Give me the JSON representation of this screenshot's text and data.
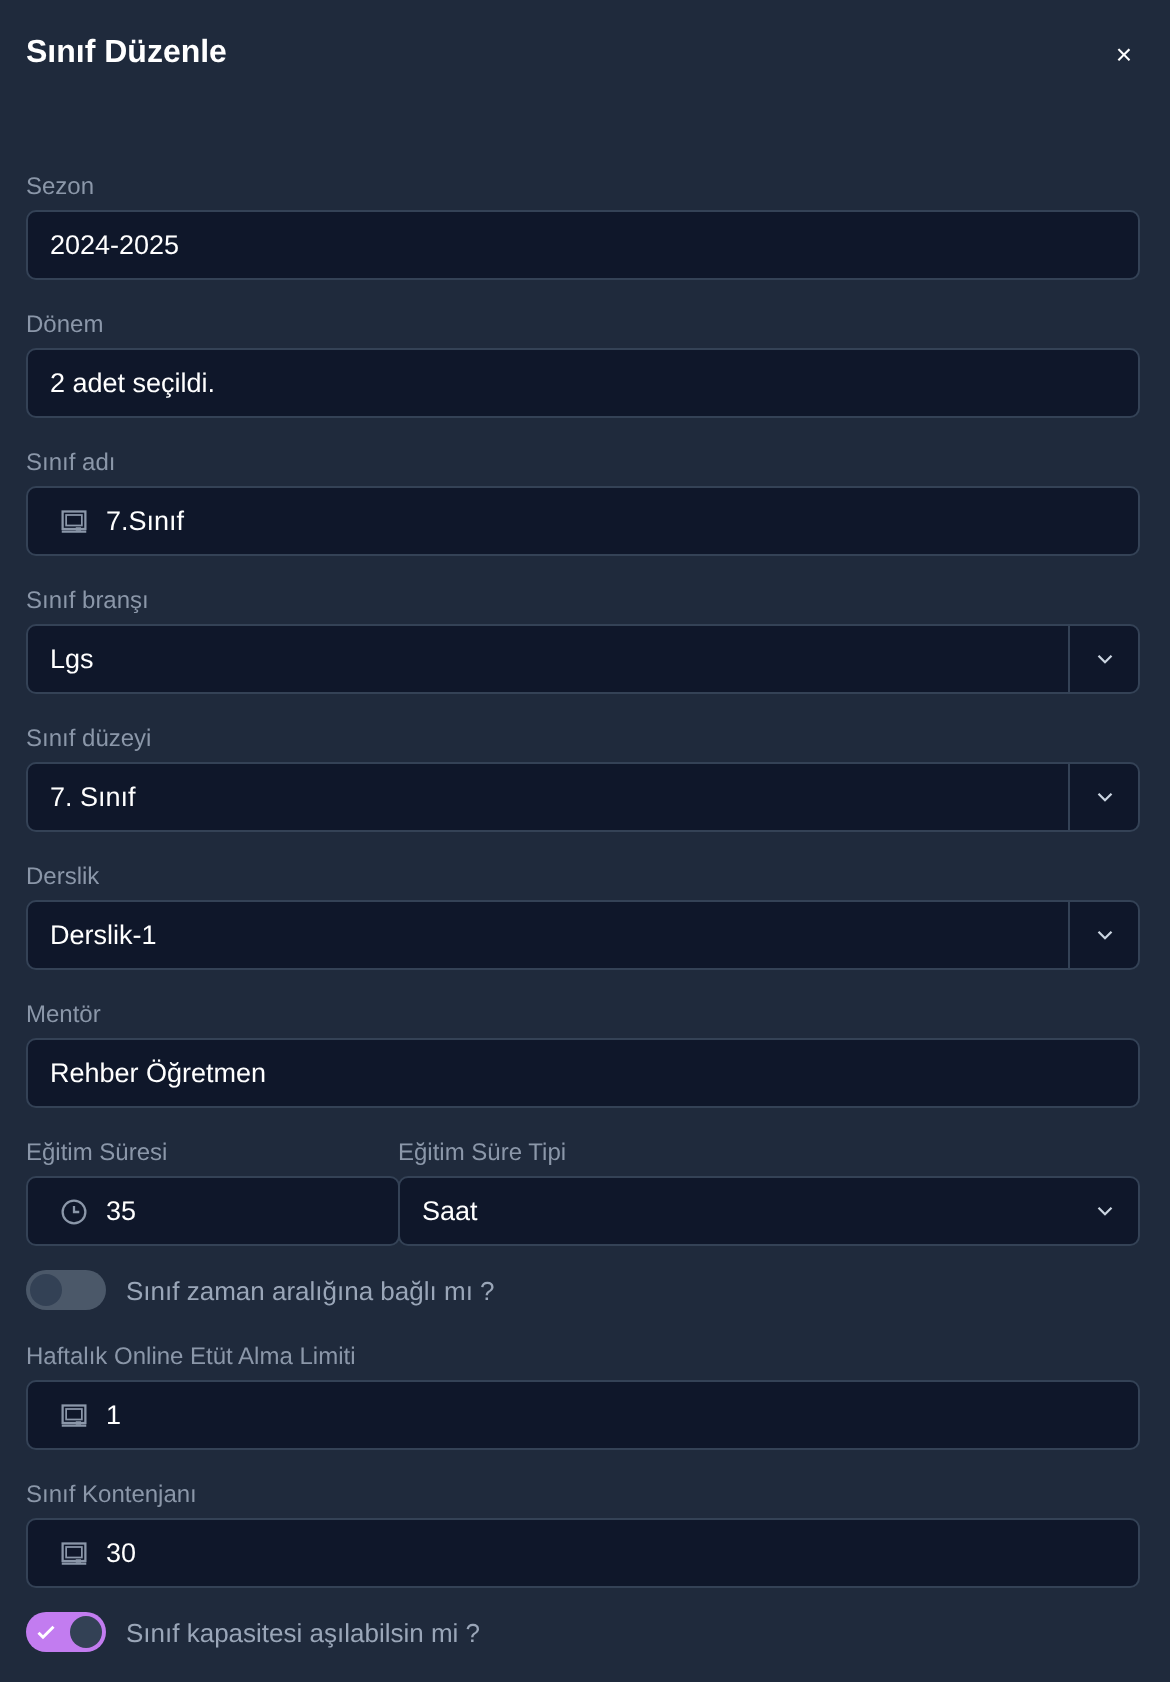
{
  "dialog": {
    "title": "Sınıf Düzenle",
    "close": "×"
  },
  "fields": [
    {
      "kind": "text",
      "label": "Sezon",
      "value": "2024-2025"
    },
    {
      "kind": "text",
      "label": "Dönem",
      "value": "2 adet seçildi."
    },
    {
      "kind": "board",
      "label": "Sınıf adı",
      "value": "7.Sınıf"
    },
    {
      "kind": "select",
      "label": "Sınıf branşı",
      "value": "Lgs"
    },
    {
      "kind": "select",
      "label": "Sınıf düzeyi",
      "value": "7. Sınıf"
    },
    {
      "kind": "select",
      "label": "Derslik",
      "value": "Derslik-1"
    },
    {
      "kind": "text",
      "label": "Mentör",
      "value": "Rehber Öğretmen"
    },
    {
      "kind": "pair",
      "items": [
        {
          "kind": "clock",
          "label": "Eğitim Süresi",
          "value": "35"
        },
        {
          "kind": "dropdown",
          "label": "Eğitim Süre Tipi",
          "value": "Saat"
        }
      ]
    },
    {
      "kind": "toggle",
      "label": "Sınıf zaman aralığına bağlı mı ?",
      "on": false
    },
    {
      "kind": "board",
      "label": "Haftalık Online Etüt Alma Limiti",
      "value": "1"
    },
    {
      "kind": "board",
      "label": "Sınıf Kontenjanı",
      "value": "30"
    },
    {
      "kind": "toggle",
      "label": "Sınıf kapasitesi aşılabilsin mi ?",
      "on": true
    }
  ]
}
